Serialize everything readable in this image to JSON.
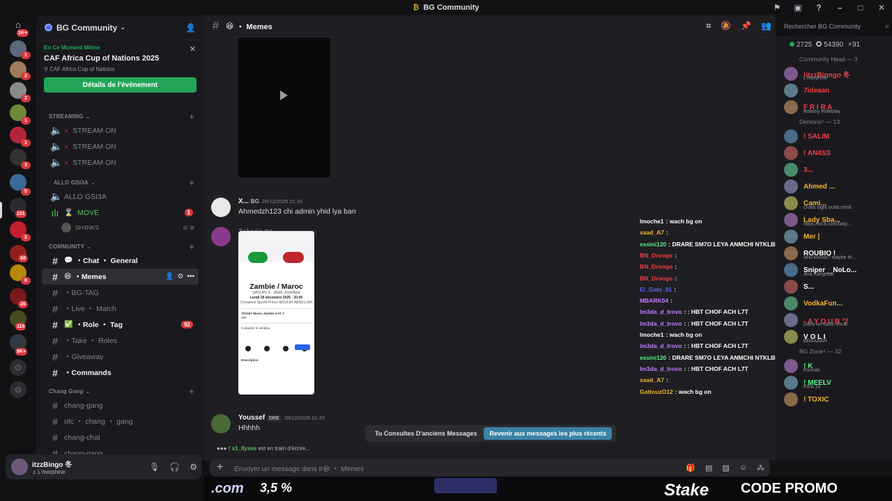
{
  "window": {
    "title": "BG Community"
  },
  "server_rail": {
    "badges": [
      "1K+",
      "1",
      "2",
      "2",
      "1",
      "1",
      "3",
      "5",
      "101",
      "2",
      "68",
      "8",
      "26",
      "119",
      "9K+"
    ]
  },
  "guild": {
    "name": "BG Community"
  },
  "event": {
    "live_label": "En Ce Moment Même",
    "title": "CAF Africa Cup of Nations 2025",
    "location": "CAF Africa Cup of Nations",
    "button": "Détails de l'événement"
  },
  "categories": {
    "streaming": "STREAMING",
    "allo": "ALLO GSI3A",
    "community": "COMMUNITY",
    "chang": "Chang Gang"
  },
  "streaming_channels": [
    "STREAM ON",
    "STREAM ON",
    "STREAM ON"
  ],
  "allo_channels": {
    "allo": "ALLO GSI3A",
    "move": "MOVE",
    "move_badge": "1",
    "member": "SH4NKS"
  },
  "community_channels": [
    {
      "label": "Chat ・ General",
      "emoji": "💬",
      "bright": true
    },
    {
      "label": "Memes",
      "emoji": "😆",
      "bright": true,
      "active": true
    },
    {
      "label": "BG-TAG",
      "emoji": "",
      "bright": false
    },
    {
      "label": "Live ・ Match",
      "emoji": "",
      "bright": false
    },
    {
      "label": "Role ・ Tag",
      "emoji": "✅",
      "bright": true,
      "badge": "92"
    },
    {
      "label": "Take ・ Roles",
      "emoji": "",
      "bright": false
    },
    {
      "label": "Giveaway",
      "emoji": "",
      "bright": false
    },
    {
      "label": "Commands",
      "emoji": "",
      "bright": true
    }
  ],
  "chang_channels": [
    "chang-gang",
    "ofc ・ chang ・ gang",
    "chang-chat",
    "chang-gang"
  ],
  "user": {
    "name": "itzzBingo 冬",
    "status": "L'morphine"
  },
  "chat": {
    "channel": "・ Memes",
    "channel_emoji": "😆",
    "search_placeholder": "Rechercher BG Community",
    "messages": [
      {
        "author": "X...",
        "tag": "BG",
        "time": "28/12/2025 21:30",
        "text": "Ahmedzh123 chi admin yhid lya ban"
      },
      {
        "author": "Zakaria",
        "tag": "BG",
        "time": "28/12/2025 21:34",
        "text": ""
      },
      {
        "author": "Youssef",
        "tag": "DRE",
        "time": "28/12/2025 21:35",
        "text": "Hhhhh"
      }
    ],
    "ticket": {
      "title": "Zambie / Maroc",
      "group": "GROUPE A · 3ÈME JOURNÉE",
      "date": "Lundi 29 décembre 2025 · 20:00",
      "venue": "Complexe Sportif Prince MOULAY ABDELLAH",
      "ticket": "TICKET Maroc Zambie CAT 3",
      "price": "250",
      "desc": "Description",
      "contact": "Contacter le vendeur",
      "msg_btn": "Envoyer"
    },
    "old_notice": "Tu Consultes D'anciens Messages",
    "jump_label": "Revenir aux messages les plus récents",
    "typing_user": "! x1_llyass",
    "typing_text": "est en train d'écrire...",
    "composer_placeholder": "Envoyer un message dans #😆 ・ Memes"
  },
  "overlay_chat": [
    {
      "user": "lmoche1",
      "text": ": wach bg on",
      "color": "#ffffff"
    },
    {
      "user": "saad_A7",
      "text": ":",
      "color": "#f0b232"
    },
    {
      "user": "essini120",
      "text": ": DRARE SM7O LEYA ANMCHI NTKLBN L ZA33IM",
      "color": "#57f287"
    },
    {
      "user": "BN_Droogo",
      "text": ":",
      "color": "#ed4245"
    },
    {
      "user": "BN_Droogo",
      "text": ":",
      "color": "#ed4245"
    },
    {
      "user": "BN_Droogo",
      "text": ":",
      "color": "#ed4245"
    },
    {
      "user": "El_Gato_01",
      "text": ":",
      "color": "#5865f2"
    },
    {
      "user": "MBARK04",
      "text": ":",
      "color": "#c77dff"
    },
    {
      "user": "lm3da_d_trovo",
      "text": ": : HBT CHOF ACH L7T",
      "color": "#c77dff"
    },
    {
      "user": "lm3da_d_trovo",
      "text": ": : HBT CHOF ACH L7T",
      "color": "#c77dff"
    },
    {
      "user": "lmoche1",
      "text": ": wach bg on",
      "color": "#ffffff"
    },
    {
      "user": "lm3da_d_trovo",
      "text": ": : HBT CHOF ACH L7T",
      "color": "#c77dff"
    },
    {
      "user": "essini120",
      "text": ": DRARE SM7O LEYA ANMCHI NTKLBN L ZA33IM",
      "color": "#57f287"
    },
    {
      "user": "lm3da_d_trovo",
      "text": ": : HBT CHOF ACH L7T",
      "color": "#c77dff"
    },
    {
      "user": "saad_A7",
      "text": ":",
      "color": "#f0b232"
    },
    {
      "user": "GattouzO12",
      "text": ": wach bg on",
      "color": "#f0b232"
    }
  ],
  "members": {
    "online": "2725",
    "offline": "54390",
    "other": "91",
    "groups": [
      {
        "title": "Community Head — 3",
        "items": [
          {
            "name": "!itzzBinngo 冬",
            "activity": "L'morphine",
            "color": "#ed4245"
          },
          {
            "name": "7ideaan",
            "activity": "",
            "color": "#ed4245"
          },
          {
            "name": "F R I R A",
            "activity": "Bobony Roleplay",
            "color": "#ed4245"
          }
        ]
      },
      {
        "title": "Demons⁴ — 13",
        "items": [
          {
            "name": "! SALIM",
            "activity": "",
            "color": "#ed4245"
          },
          {
            "name": "! AN4SS",
            "activity": "",
            "color": "#ed4245"
          },
          {
            "name": "3...",
            "activity": "",
            "color": "#ed4245"
          },
          {
            "name": "Ahmed ...",
            "activity": "",
            "color": "#f0b232"
          },
          {
            "name": "Cami...",
            "activity": "Outta sight outta mind",
            "color": "#f0b232"
          },
          {
            "name": "Lady Sba...",
            "activity": "https://kick.com/lady...",
            "color": "#f0b232"
          },
          {
            "name": "Mer |",
            "activity": "",
            "color": "#f0b232"
          },
          {
            "name": "ROUBIO !",
            "activity": "who knows? maybe th...",
            "color": "#ffffff"
          },
          {
            "name": "Sniper__NoLo...",
            "activity": "Ana Kangolak",
            "color": "#ffffff"
          },
          {
            "name": "S...",
            "activity": "",
            "color": "#ffffff"
          },
          {
            "name": "VodkaFun...",
            "activity": "",
            "color": "#f0b232"
          },
          {
            "name": "· A Y O U B ツ",
            "activity": "Dans un salon vocal",
            "color": "#ed4245"
          },
          {
            "name": "V O L I",
            "activity": "BRAAAAH",
            "color": "#ffffff"
          }
        ]
      },
      {
        "title": "BG Zone⁴ — 32",
        "items": [
          {
            "name": "! K",
            "activity": "Fortnite",
            "color": "#57f287"
          },
          {
            "name": "! MEELV",
            "activity": "FIFA 19",
            "color": "#57f287"
          },
          {
            "name": "! TOXIC",
            "activity": "",
            "color": "#f0b232"
          }
        ]
      }
    ]
  },
  "promo": {
    "left": ".com",
    "mid": "3,5 %",
    "brand": "Stake",
    "code": "CODE PROMO"
  },
  "colors": {
    "accent": "#5865f2",
    "green": "#23a559",
    "red": "#da373c"
  }
}
